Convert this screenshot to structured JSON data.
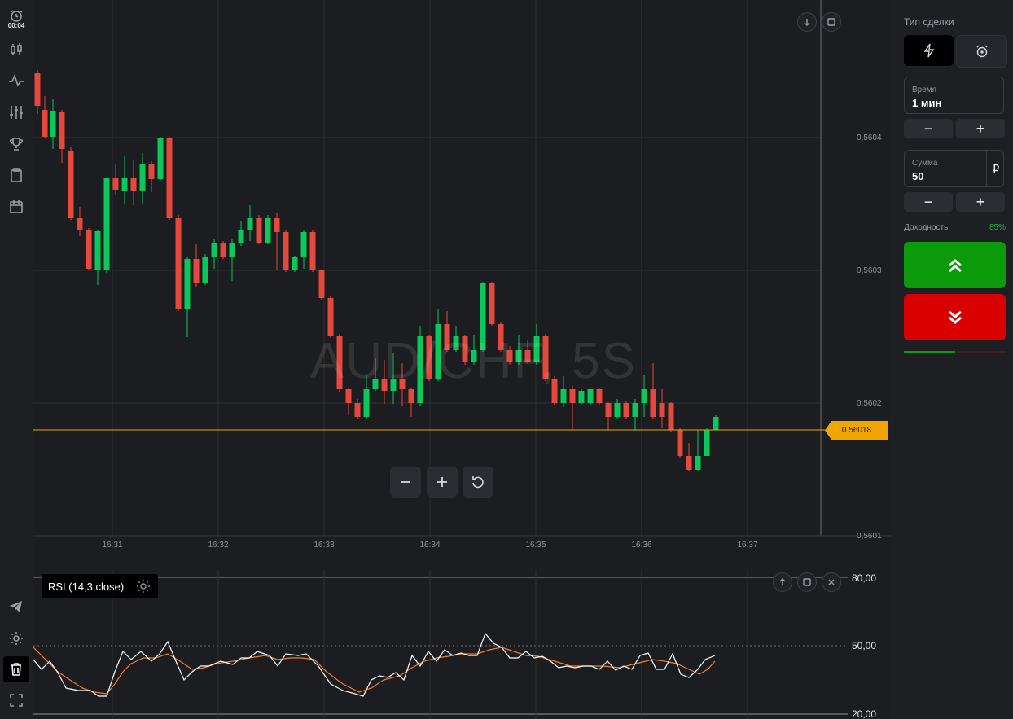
{
  "toolbar": {
    "timer": "00:04",
    "items": [
      "alarm-clock-icon",
      "candlestick-icon",
      "indicator-icon",
      "sliders-icon",
      "trophy-icon",
      "clipboard-icon",
      "calendar-icon",
      "telegram-icon",
      "settings-icon",
      "trash-icon",
      "fullscreen-icon"
    ]
  },
  "chart": {
    "watermark": "AUD/CHF, 5S",
    "current_price": "0.56018",
    "price_ticks": [
      "0,5604",
      "0,5603",
      "0,5602",
      "0,5601"
    ],
    "time_ticks": [
      "16:31",
      "16:32",
      "16:33",
      "16:34",
      "16:35",
      "16:36",
      "16:37"
    ],
    "colors": {
      "up": "#0ac85a",
      "down": "#e5483c",
      "price_line": "#f0a500",
      "rsi": "#ffffff",
      "rsi_signal": "#f07f2a"
    }
  },
  "rsi": {
    "label": "RSI (14,3,close)",
    "levels": [
      "80,00",
      "50,00",
      "20,00"
    ]
  },
  "panel": {
    "title": "Тип сделки",
    "time_label": "Время",
    "time_value": "1 мин",
    "amount_label": "Сумма",
    "amount_value": "50",
    "currency": "₽",
    "minus": "−",
    "plus": "+",
    "yield_label": "Доходность",
    "yield_value": "85%"
  }
}
